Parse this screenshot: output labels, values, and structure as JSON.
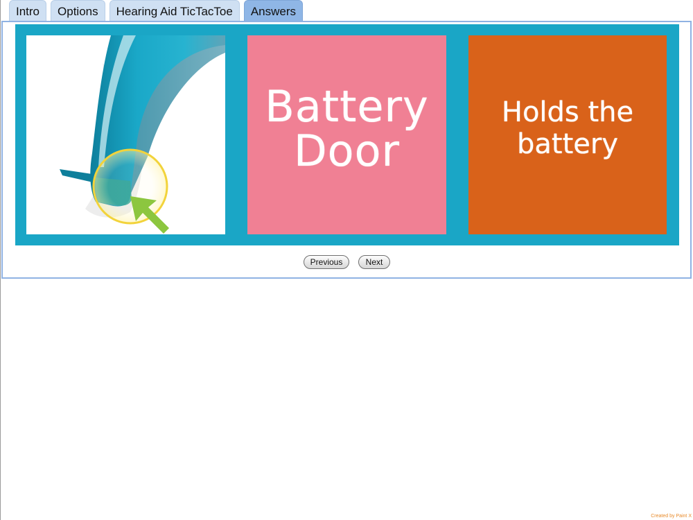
{
  "tabs": [
    {
      "label": "Intro"
    },
    {
      "label": "Options"
    },
    {
      "label": "Hearing Aid TicTacToe"
    },
    {
      "label": "Answers"
    }
  ],
  "active_tab": "Answers",
  "card": {
    "image": {
      "icon": "battery-door-illustration-icon"
    },
    "term": "Battery Door",
    "definition": "Holds the battery"
  },
  "nav": {
    "previous_label": "Previous",
    "next_label": "Next"
  },
  "footer": {
    "credit": "Created by Paint X"
  },
  "colors": {
    "tab": "#cfe0f3",
    "tab_active": "#8fb6e6",
    "strip": "#1aa6c6",
    "term_card": "#f08094",
    "definition_card": "#d9621a",
    "highlight_ring": "#f2d33b",
    "arrow": "#8cc63f"
  }
}
